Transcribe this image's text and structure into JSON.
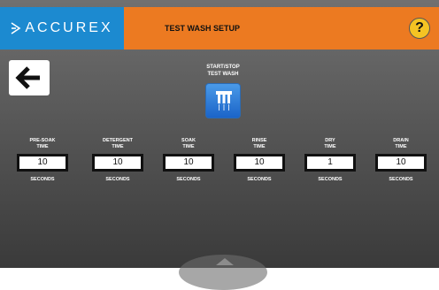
{
  "brand": {
    "name": "ACCUREX",
    "color": "#1c8ad0"
  },
  "header": {
    "title": "TEST WASH SETUP",
    "help_label": "?",
    "color": "#ec7a21"
  },
  "back": {
    "icon": "arrow-left-icon"
  },
  "start_stop": {
    "line1": "START/STOP",
    "line2": "TEST WASH",
    "icon": "spray-nozzle-icon"
  },
  "settings": [
    {
      "label1": "PRE-SOAK",
      "label2": "TIME",
      "value": "10",
      "unit": "SECONDS"
    },
    {
      "label1": "DETERGENT",
      "label2": "TIME",
      "value": "10",
      "unit": "SECONDS"
    },
    {
      "label1": "SOAK",
      "label2": "TIME",
      "value": "10",
      "unit": "SECONDS"
    },
    {
      "label1": "RINSE",
      "label2": "TIME",
      "value": "10",
      "unit": "SECONDS"
    },
    {
      "label1": "DRY",
      "label2": "TIME",
      "value": "1",
      "unit": "SECONDS"
    },
    {
      "label1": "DRAIN",
      "label2": "TIME",
      "value": "10",
      "unit": "SECONDS"
    }
  ]
}
